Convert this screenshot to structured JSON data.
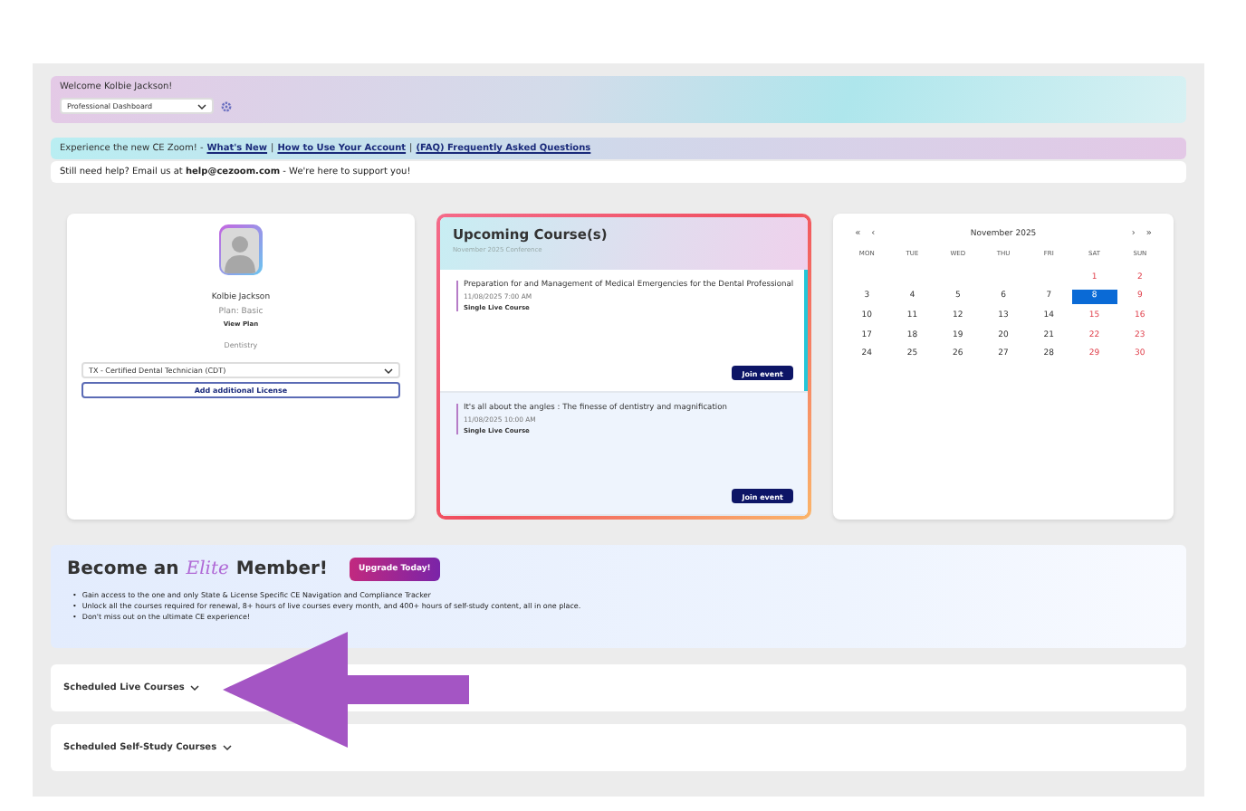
{
  "welcome": {
    "title": "Welcome Kolbie Jackson!",
    "dashboard_select": {
      "value": "Professional Dashboard"
    }
  },
  "announcement": {
    "text": "Experience the new CE Zoom! -",
    "links": [
      {
        "label": "What's New"
      },
      {
        "label": "How to Use Your Account"
      },
      {
        "label": "(FAQ) Frequently Asked Questions"
      }
    ],
    "separator": "|"
  },
  "help": {
    "text": "Still need help? Email us at **help@cezoom.com** - We're here to support you!"
  },
  "profile": {
    "name": "Kolbie Jackson",
    "plan": "Plan: Basic",
    "view_plan": "View Plan",
    "profession": "Dentistry",
    "license_select": {
      "value": "TX - Certified Dental Technician (CDT)"
    },
    "add_license": "Add additional License"
  },
  "upcoming": {
    "title": "Upcoming Course(s)",
    "subtitle": "November 2025 Conference",
    "courses": [
      {
        "title": "Preparation for and Management of Medical Emergencies for the Dental Professional",
        "datetime": "11/08/2025 7:00 AM",
        "type": "Single Live Course",
        "button": "Join event"
      },
      {
        "title": "It's all about the angles : The finesse of dentistry and magnification",
        "datetime": "11/08/2025 10:00 AM",
        "type": "Single Live Course",
        "button": "Join event"
      }
    ]
  },
  "calendar": {
    "month": "November 2025",
    "nav": {
      "prev_year": "«",
      "prev": "‹",
      "next": "›",
      "next_year": "»"
    },
    "weekdays": [
      "MON",
      "TUE",
      "WED",
      "THU",
      "FRI",
      "SAT",
      "SUN"
    ],
    "weeks": [
      [
        {
          "day": "1",
          "weekend": true,
          "selected": false
        },
        {
          "day": "2",
          "weekend": true,
          "selected": false
        }
      ],
      [
        {
          "day": "3",
          "weekend": false,
          "selected": false
        },
        {
          "day": "4",
          "weekend": false,
          "selected": false
        },
        {
          "day": "5",
          "weekend": false,
          "selected": false
        },
        {
          "day": "6",
          "weekend": false,
          "selected": false
        },
        {
          "day": "7",
          "weekend": false,
          "selected": false
        },
        {
          "day": "8",
          "weekend": true,
          "selected": true
        },
        {
          "day": "9",
          "weekend": true,
          "selected": false
        }
      ],
      [
        {
          "day": "10",
          "weekend": false,
          "selected": false
        },
        {
          "day": "11",
          "weekend": false,
          "selected": false
        },
        {
          "day": "12",
          "weekend": false,
          "selected": false
        },
        {
          "day": "13",
          "weekend": false,
          "selected": false
        },
        {
          "day": "14",
          "weekend": false,
          "selected": false
        },
        {
          "day": "15",
          "weekend": true,
          "selected": false
        },
        {
          "day": "16",
          "weekend": true,
          "selected": false
        }
      ],
      [
        {
          "day": "17",
          "weekend": false,
          "selected": false
        },
        {
          "day": "18",
          "weekend": false,
          "selected": false
        },
        {
          "day": "19",
          "weekend": false,
          "selected": false
        },
        {
          "day": "20",
          "weekend": false,
          "selected": false
        },
        {
          "day": "21",
          "weekend": false,
          "selected": false
        },
        {
          "day": "22",
          "weekend": true,
          "selected": false
        },
        {
          "day": "23",
          "weekend": true,
          "selected": false
        }
      ],
      [
        {
          "day": "24",
          "weekend": false,
          "selected": false
        },
        {
          "day": "25",
          "weekend": false,
          "selected": false
        },
        {
          "day": "26",
          "weekend": false,
          "selected": false
        },
        {
          "day": "27",
          "weekend": false,
          "selected": false
        },
        {
          "day": "28",
          "weekend": false,
          "selected": false
        },
        {
          "day": "29",
          "weekend": true,
          "selected": false
        },
        {
          "day": "30",
          "weekend": true,
          "selected": false
        }
      ]
    ]
  },
  "elite": {
    "title_start": "Become an",
    "logo": "Elite",
    "title_end": "Member!",
    "button": "Upgrade Today!",
    "bullet_marker": "•",
    "bullets": [
      "Gain access to the one and only State & License Specific CE Navigation and Compliance Tracker",
      "Unlock all the courses required for renewal, 8+ hours of live courses every month, and 400+ hours of self-study content, all in one place.",
      "Don't miss out on the ultimate CE experience!"
    ]
  },
  "sections": [
    {
      "label": "Scheduled Live Courses",
      "expanded": false
    },
    {
      "label": "Scheduled Self-Study Courses",
      "expanded": false
    }
  ]
}
